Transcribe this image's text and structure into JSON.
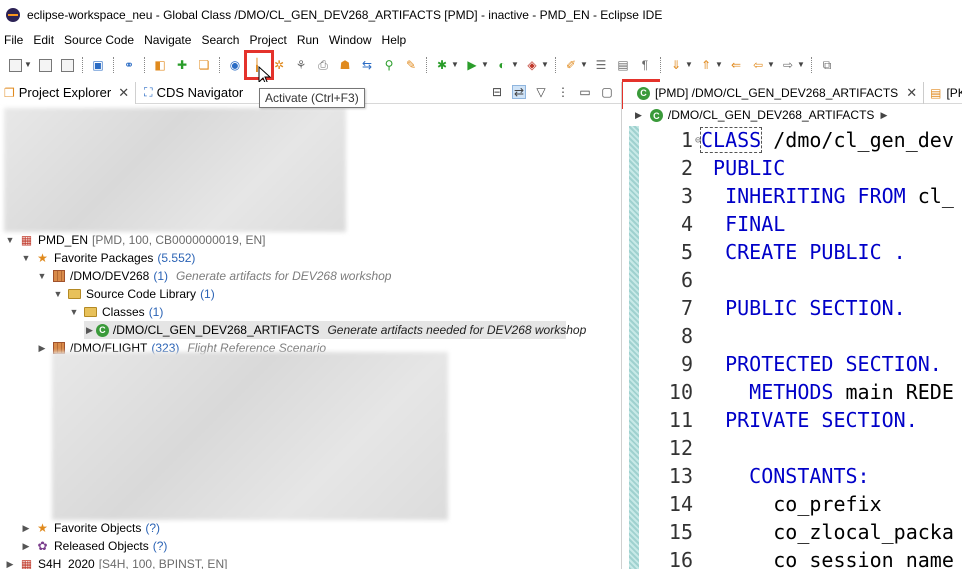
{
  "window": {
    "title": "eclipse-workspace_neu - Global Class /DMO/CL_GEN_DEV268_ARTIFACTS [PMD]  - inactive - PMD_EN - Eclipse IDE"
  },
  "menu": [
    "File",
    "Edit",
    "Source Code",
    "Navigate",
    "Search",
    "Project",
    "Run",
    "Window",
    "Help"
  ],
  "toolbar": {
    "tooltip": "Activate (Ctrl+F3)"
  },
  "left_panel": {
    "tabs": [
      {
        "label": "Project Explorer",
        "active": true
      },
      {
        "label": "CDS Navigator",
        "active": false
      }
    ],
    "tree": {
      "project": {
        "name": "PMD_EN",
        "meta": "[PMD, 100, CB0000000019, EN]"
      },
      "favorite_packages": {
        "label": "Favorite Packages",
        "count": "(5.552)"
      },
      "package_dev268": {
        "name": "/DMO/DEV268",
        "count": "(1)",
        "desc": "Generate artifacts for DEV268 workshop"
      },
      "source_code_library": {
        "label": "Source Code Library",
        "count": "(1)"
      },
      "classes": {
        "label": "Classes",
        "count": "(1)"
      },
      "class_item": {
        "name": "/DMO/CL_GEN_DEV268_ARTIFACTS",
        "desc": "Generate artifacts needed for DEV268 workshop"
      },
      "package_flight": {
        "name": "/DMO/FLIGHT",
        "count": "(323)",
        "desc": "Flight Reference Scenario"
      },
      "favorite_objects": {
        "label": "Favorite Objects",
        "count": "(?)"
      },
      "released_objects": {
        "label": "Released Objects",
        "count": "(?)"
      },
      "s4h_project": {
        "name": "S4H_2020",
        "meta": "[S4H, 100, BPINST, EN]"
      }
    }
  },
  "editor": {
    "tabs": [
      {
        "label": "[PMD] /DMO/CL_GEN_DEV268_ARTIFACTS",
        "active": true
      },
      {
        "label": "[PKD] Z",
        "active": false
      }
    ],
    "breadcrumb": "/DMO/CL_GEN_DEV268_ARTIFACTS",
    "lines": [
      {
        "n": "1",
        "kw": "CLASS",
        "rest": " /dmo/cl_gen_dev"
      },
      {
        "n": "2",
        "kw": " PUBLIC",
        "rest": ""
      },
      {
        "n": "3",
        "kw": "  INHERITING FROM",
        "rest": " cl_"
      },
      {
        "n": "4",
        "kw": "  FINAL",
        "rest": ""
      },
      {
        "n": "5",
        "kw": "  CREATE PUBLIC .",
        "rest": ""
      },
      {
        "n": "6",
        "kw": "",
        "rest": ""
      },
      {
        "n": "7",
        "kw": "  PUBLIC SECTION.",
        "rest": ""
      },
      {
        "n": "8",
        "kw": "",
        "rest": ""
      },
      {
        "n": "9",
        "kw": "  PROTECTED SECTION.",
        "rest": ""
      },
      {
        "n": "10",
        "kw": "    METHODS",
        "rest": " main REDE"
      },
      {
        "n": "11",
        "kw": "  PRIVATE SECTION.",
        "rest": ""
      },
      {
        "n": "12",
        "kw": "",
        "rest": ""
      },
      {
        "n": "13",
        "kw": "    CONSTANTS:",
        "rest": ""
      },
      {
        "n": "14",
        "kw": "",
        "rest": "      co_prefix"
      },
      {
        "n": "15",
        "kw": "",
        "rest": "      co_zlocal_packa"
      },
      {
        "n": "16",
        "kw": "",
        "rest": "      co_session_name"
      }
    ]
  },
  "colors": {
    "highlight": "#e4322b",
    "keyword": "#0000c8",
    "count": "#2b63b5"
  }
}
